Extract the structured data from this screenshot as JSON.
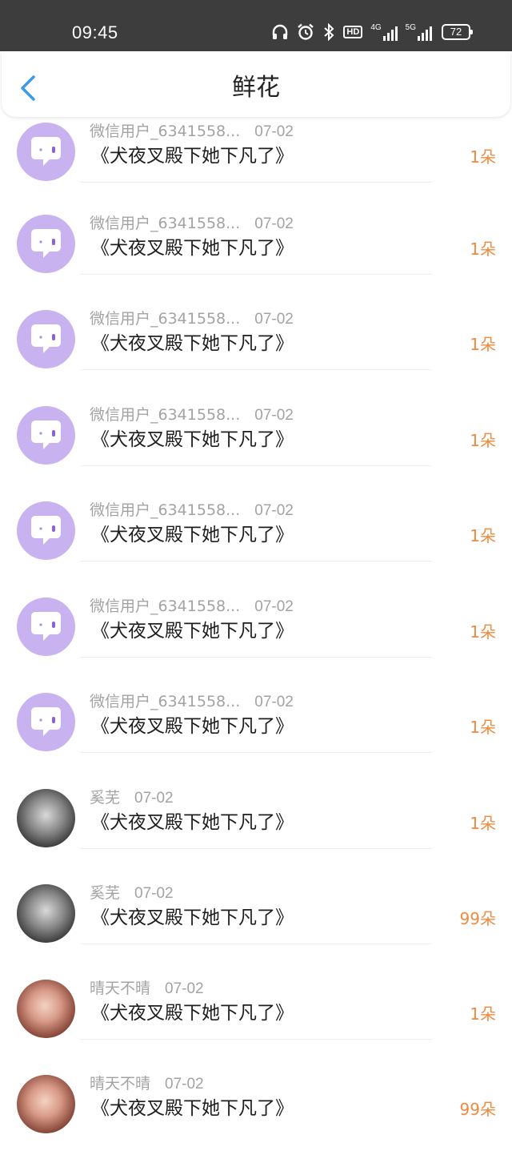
{
  "status_bar": {
    "time": "09:45",
    "hd_label": "HD",
    "net1": "4G",
    "net2": "5G",
    "battery": "72"
  },
  "header": {
    "title": "鲜花"
  },
  "items": [
    {
      "avatar": "chat-bubble-avatar",
      "name": "微信用户_6341558...",
      "date": "07-02",
      "book": "《犬夜叉殿下她下凡了》",
      "count": "1朵"
    },
    {
      "avatar": "chat-bubble-avatar",
      "name": "微信用户_6341558...",
      "date": "07-02",
      "book": "《犬夜叉殿下她下凡了》",
      "count": "1朵"
    },
    {
      "avatar": "chat-bubble-avatar",
      "name": "微信用户_6341558...",
      "date": "07-02",
      "book": "《犬夜叉殿下她下凡了》",
      "count": "1朵"
    },
    {
      "avatar": "chat-bubble-avatar",
      "name": "微信用户_6341558...",
      "date": "07-02",
      "book": "《犬夜叉殿下她下凡了》",
      "count": "1朵"
    },
    {
      "avatar": "chat-bubble-avatar",
      "name": "微信用户_6341558...",
      "date": "07-02",
      "book": "《犬夜叉殿下她下凡了》",
      "count": "1朵"
    },
    {
      "avatar": "chat-bubble-avatar",
      "name": "微信用户_6341558...",
      "date": "07-02",
      "book": "《犬夜叉殿下她下凡了》",
      "count": "1朵"
    },
    {
      "avatar": "chat-bubble-avatar",
      "name": "微信用户_6341558...",
      "date": "07-02",
      "book": "《犬夜叉殿下她下凡了》",
      "count": "1朵"
    },
    {
      "avatar": "photo-avatar-gray",
      "name": "奚芜",
      "date": "07-02",
      "book": "《犬夜叉殿下她下凡了》",
      "count": "1朵"
    },
    {
      "avatar": "photo-avatar-gray",
      "name": "奚芜",
      "date": "07-02",
      "book": "《犬夜叉殿下她下凡了》",
      "count": "99朵"
    },
    {
      "avatar": "photo-avatar-rose",
      "name": "晴天不晴",
      "date": "07-02",
      "book": "《犬夜叉殿下她下凡了》",
      "count": "1朵"
    },
    {
      "avatar": "photo-avatar-rose",
      "name": "晴天不晴",
      "date": "07-02",
      "book": "《犬夜叉殿下她下凡了》",
      "count": "99朵"
    }
  ],
  "colors": {
    "status_bar_bg": "#3d3d3d",
    "accent_blue": "#3b9be8",
    "count_orange": "#f08a3e",
    "avatar_purple": "#c9b2f0",
    "meta_gray": "#a3a3a3"
  }
}
